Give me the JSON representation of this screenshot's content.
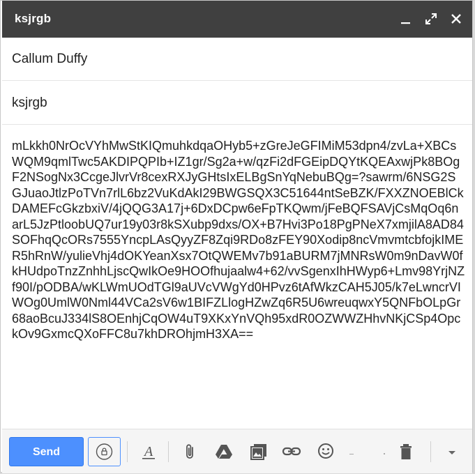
{
  "window": {
    "title": "ksjrgb"
  },
  "recipients": {
    "value": "Callum Duffy"
  },
  "subject": {
    "value": "ksjrgb"
  },
  "body": {
    "text": "mLkkh0NrOcVYhMwStKIQmuhkdqaOHyb5+zGreJeGFIMiM53dpn4/zvLa+XBCsWQM9qmlTwc5AKDIPQPIb+IZ1gr/Sg2a+w/qzFi2dFGEipDQYtKQEAxwjPk8BOgF2NSogNx3CcgeJlvrVr8cexRXJyGHtsIxELBgSnYqNebuBQg=?sawrm/6NSG2SGJuaoJtlzPoTVn7rlL6bz2VuKdAkI29BWGSQX3C51644ntSeBZK/FXXZNOEBlCkDAMEFcGkzbxiV/4jQQG3A17j+6DxDCpw6eFpTKQwm/jFeBQFSAVjCsMqOq6narL5JzPtloobUQ7ur19y03r8kSXubp9dxs/OX+B7Hvi3Po18PgPNeX7xmjilA8AD84SOFhqQcORs7555YncpLAsQyyZF8Zqi9RDo8zFEY90Xodip8ncVmvmtcbfojkIMER5hRnW/yulieVhj4dOKYeanXsx7OtQWEMv7b91aBURM7jMNRsW0m9nDavW0fkHUdpoTnzZnhhLjscQwIkOe9HOOfhujaalw4+62/vvSgenxIhHWyp6+Lmv98YrjNZf90I/pODBA/wKLWmUOdTGl9aUVcVWgYd0HPvz6tAfWkzCAH5J05/k7eLwncrVIWOg0UmlW0Nml44VCa2sV6w1BIFZLlogHZwZq6R5U6wreuqwxY5QNFbOLpGr68aoBcuJ334lS8OEnhjCqOW4uT9XKxYnVQh95xdR0OZWWZHhvNKjCSp4OpckOv9GxmcQXoFFC8u7khDROhjmH3XA=="
  },
  "toolbar": {
    "send_label": "Send",
    "icons": [
      "lock-icon",
      "format-text-icon",
      "attach-icon",
      "drive-icon",
      "photo-icon",
      "link-icon",
      "emoji-icon",
      "delete-icon",
      "more-options-icon"
    ]
  },
  "colors": {
    "titlebar": "#404040",
    "send_button": "#4d90fe"
  }
}
